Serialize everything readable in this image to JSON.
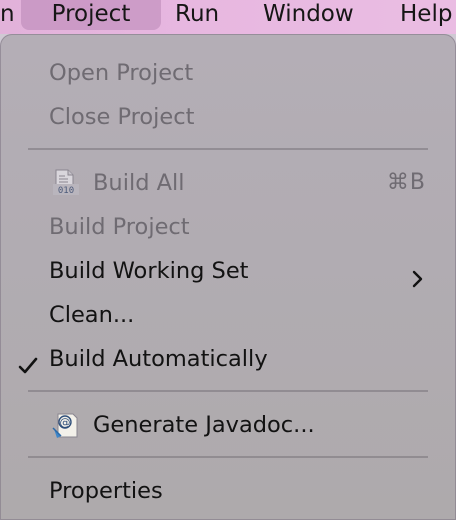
{
  "menubar": {
    "items": [
      {
        "label": "n"
      },
      {
        "label": "Project"
      },
      {
        "label": "Run"
      },
      {
        "label": "Window"
      },
      {
        "label": "Help"
      }
    ]
  },
  "menu": {
    "open_project": "Open Project",
    "close_project": "Close Project",
    "build_all": "Build All",
    "build_all_shortcut": "⌘B",
    "build_project": "Build Project",
    "build_working_set": "Build Working Set",
    "clean": "Clean...",
    "build_automatically": "Build Automatically",
    "generate_javadoc": "Generate Javadoc...",
    "properties": "Properties"
  },
  "icons": {
    "build_all": "binary-file-icon",
    "generate_javadoc": "javadoc-icon",
    "build_working_set": "chevron-right-icon",
    "build_automatically": "checkmark-icon"
  },
  "colors": {
    "menubar": "#e5b6de",
    "menu_background": "#b2adb4",
    "disabled_text": "#6f6b72",
    "enabled_text": "#121212"
  }
}
